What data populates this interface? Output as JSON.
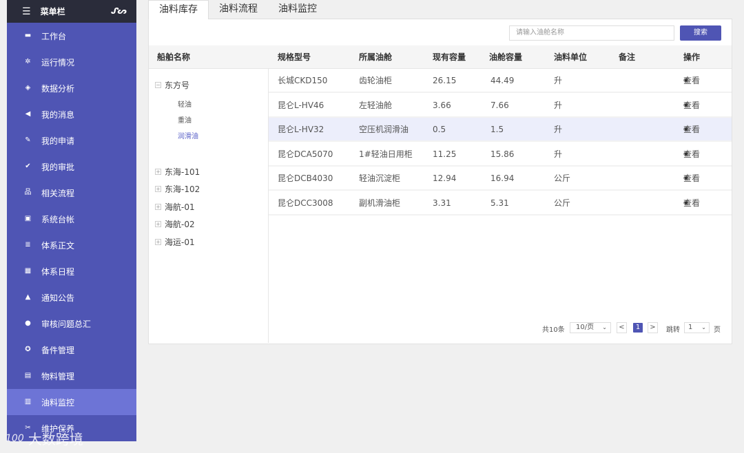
{
  "sidebar": {
    "title": "菜单栏",
    "items": [
      {
        "label": "工作台",
        "icon": "monitor-icon"
      },
      {
        "label": "运行情况",
        "icon": "spinner-icon"
      },
      {
        "label": "数据分析",
        "icon": "layers-icon"
      },
      {
        "label": "我的消息",
        "icon": "speaker-icon"
      },
      {
        "label": "我的申请",
        "icon": "edit-icon"
      },
      {
        "label": "我的审批",
        "icon": "clipboard-check-icon"
      },
      {
        "label": "相关流程",
        "icon": "sitemap-icon"
      },
      {
        "label": "系统台帐",
        "icon": "book-icon"
      },
      {
        "label": "体系正文",
        "icon": "document-icon"
      },
      {
        "label": "体系日程",
        "icon": "calendar-icon"
      },
      {
        "label": "通知公告",
        "icon": "bell-icon"
      },
      {
        "label": "审核问题总汇",
        "icon": "user-icon"
      },
      {
        "label": "备件管理",
        "icon": "gear-icon"
      },
      {
        "label": "物料管理",
        "icon": "box-icon"
      },
      {
        "label": "油料监控",
        "icon": "tank-icon"
      },
      {
        "label": "维护保养",
        "icon": "wrench-icon"
      }
    ],
    "active_index": 14
  },
  "tabs": [
    "油料库存",
    "油料流程",
    "油料监控"
  ],
  "search": {
    "placeholder": "请输入油舱名称",
    "button": "搜索"
  },
  "columns": {
    "ship": "船舶名称",
    "model": "规格型号",
    "tank": "所属油舱",
    "current": "现有容量",
    "capacity": "油舱容量",
    "unit": "油料单位",
    "remark": "备注",
    "action": "操作"
  },
  "tree": {
    "expanded": {
      "label": "东方号",
      "toggle": "−",
      "children": [
        "轻油",
        "重油",
        "润滑油"
      ],
      "selected_child": 2
    },
    "collapsed": [
      {
        "label": "东海-101",
        "toggle": "+"
      },
      {
        "label": "东海-102",
        "toggle": "+"
      },
      {
        "label": "海航-01",
        "toggle": "+"
      },
      {
        "label": "海航-02",
        "toggle": "+"
      },
      {
        "label": "海运-01",
        "toggle": "+"
      }
    ]
  },
  "rows": [
    {
      "model": "长城CKD150",
      "tank": "齿轮油柜",
      "current": "26.15",
      "capacity": "44.49",
      "unit": "升",
      "action": "查看"
    },
    {
      "model": "昆仑L-HV46",
      "tank": "左轻油舱",
      "current": "3.66",
      "capacity": "7.66",
      "unit": "升",
      "action": "查看"
    },
    {
      "model": "昆仑L-HV32",
      "tank": "空压机润滑油",
      "current": "0.5",
      "capacity": "1.5",
      "unit": "升",
      "action": "查看"
    },
    {
      "model": "昆仑DCA5070",
      "tank": "1#轻油日用柜",
      "current": "11.25",
      "capacity": "15.86",
      "unit": "升",
      "action": "查看"
    },
    {
      "model": "昆仑DCB4030",
      "tank": "轻油沉淀柜",
      "current": "12.94",
      "capacity": "16.94",
      "unit": "公斤",
      "action": "查看"
    },
    {
      "model": "昆仑DCC3008",
      "tank": "副机滑油柜",
      "current": "3.31",
      "capacity": "5.31",
      "unit": "公斤",
      "action": "查看"
    }
  ],
  "highlighted_row": 2,
  "pagination": {
    "total": "共10条",
    "page_size": "10/页",
    "prev": "<",
    "current_page": "1",
    "next": ">",
    "jump_label": "跳转",
    "jump_value": "1",
    "page_suffix": "页"
  },
  "watermark": {
    "logo": "100",
    "text": "大数跨境"
  },
  "colors": {
    "sidebar": "#4f55b4",
    "sidebar_active": "#6d74d6",
    "sidebar_header": "#2a2c3a",
    "accent": "#4f55b4",
    "row_highlight": "#eceefb"
  }
}
